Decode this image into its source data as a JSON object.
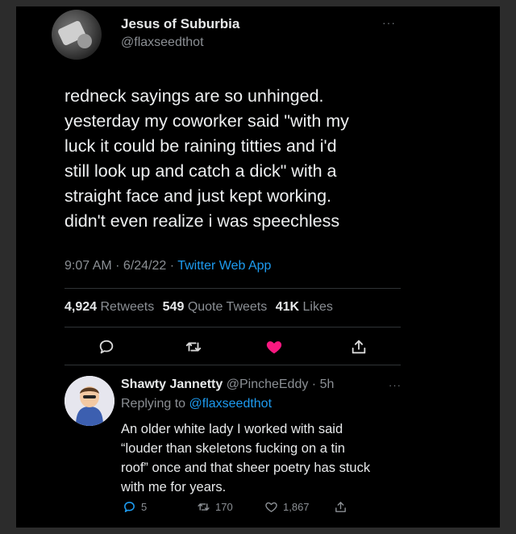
{
  "tweet": {
    "display_name": "Jesus of Suburbia",
    "handle": "@flaxseedthot",
    "more": "···",
    "text": "redneck sayings are so unhinged.\nyesterday my coworker said \"with my\nluck it could be raining titties and i'd\nstill look up and catch a dick\" with a\nstraight face and just kept working.\ndidn't even realize i was speechless",
    "time": "9:07 AM · 6/24/22 · ",
    "source": "Twitter Web App",
    "stats": {
      "retweets_count": "4,924",
      "retweets_label": "Retweets",
      "quotes_count": "549",
      "quotes_label": "Quote Tweets",
      "likes_count": "41K",
      "likes_label": "Likes"
    },
    "liked": true,
    "colors": {
      "accent": "#1d9bf0",
      "like": "#f91880",
      "muted": "#8b8f94"
    }
  },
  "reply": {
    "display_name": "Shawty Jannetty",
    "handle_time": "@PincheEddy · 5h",
    "more": "···",
    "replying_prefix": "Replying to",
    "replying_to": "@flaxseedthot",
    "text": "An older white lady I worked with said\n“louder than skeletons fucking on a tin\nroof” once and that sheer poetry has stuck\nwith me for years.",
    "replies": "5",
    "retweets": "170",
    "likes": "1,867"
  },
  "icons": [
    "reply-icon",
    "retweet-icon",
    "heart-icon",
    "share-icon"
  ]
}
